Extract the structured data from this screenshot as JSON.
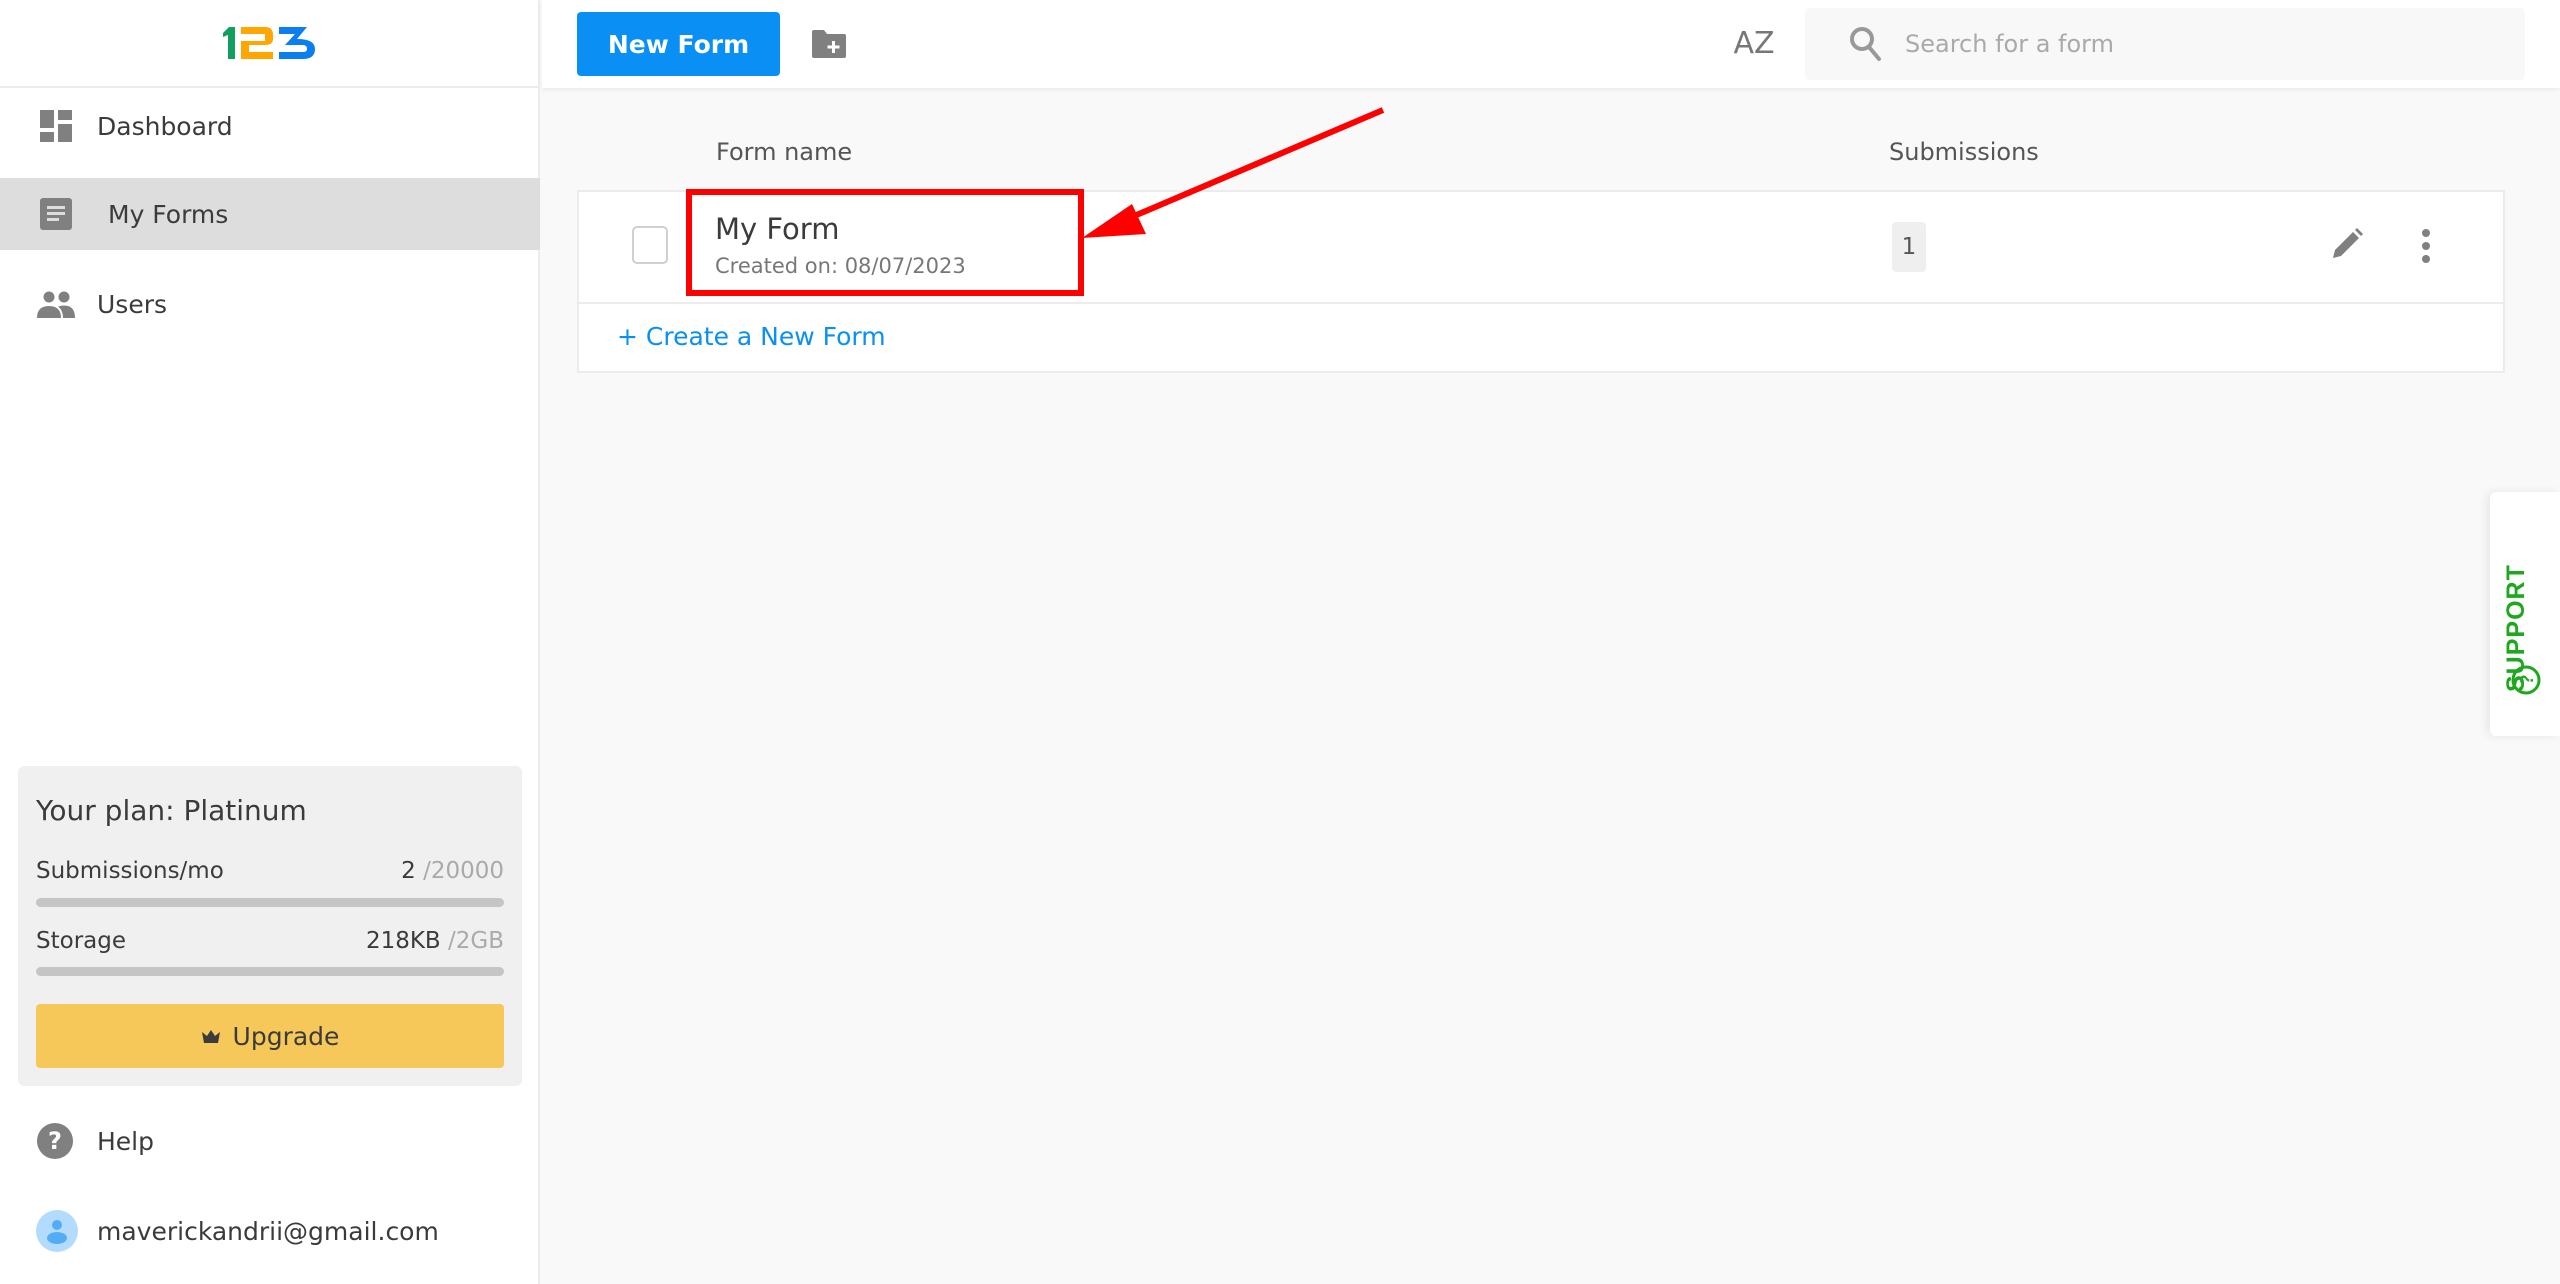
{
  "app": {
    "logo_text": "123",
    "logo_colors": [
      "#0fa05d",
      "#ffa600",
      "#0b7ef0"
    ]
  },
  "sidebar": {
    "items": [
      {
        "label": "Dashboard",
        "icon": "dashboard-icon",
        "active": false
      },
      {
        "label": "My Forms",
        "icon": "form-icon",
        "active": true
      },
      {
        "label": "Users",
        "icon": "users-icon",
        "active": false
      }
    ],
    "plan": {
      "title": "Your plan: Platinum",
      "submissions": {
        "label": "Submissions/mo",
        "used": "2",
        "limit": "/20000",
        "fraction": 0.0001
      },
      "storage": {
        "label": "Storage",
        "used": "218KB",
        "limit": "/2GB",
        "fraction": 0.0001
      },
      "upgrade_label": "Upgrade",
      "upgrade_icon": "crown-icon"
    },
    "help_label": "Help",
    "account_email": "maverickandrii@gmail.com"
  },
  "toolbar": {
    "new_form_label": "New Form",
    "new_folder_icon": "folder-plus-icon",
    "sort_icon": "sort-az-icon",
    "sort_label": "AZ",
    "search_placeholder": "Search for a form",
    "search_value": ""
  },
  "table": {
    "columns": [
      "Form name",
      "Submissions"
    ],
    "rows": [
      {
        "name": "My Form",
        "created": "Created on: 08/07/2023",
        "submissions": "1"
      }
    ],
    "create_link": "+ Create a New Form"
  },
  "support": {
    "label": "SUPPORT",
    "color": "#1ea81e"
  },
  "annotation": {
    "color": "#ff0000",
    "target": "My Form"
  },
  "colors": {
    "accent": "#0a8ff5",
    "upgrade": "#f6c85a",
    "active_nav": "#dddddd"
  }
}
